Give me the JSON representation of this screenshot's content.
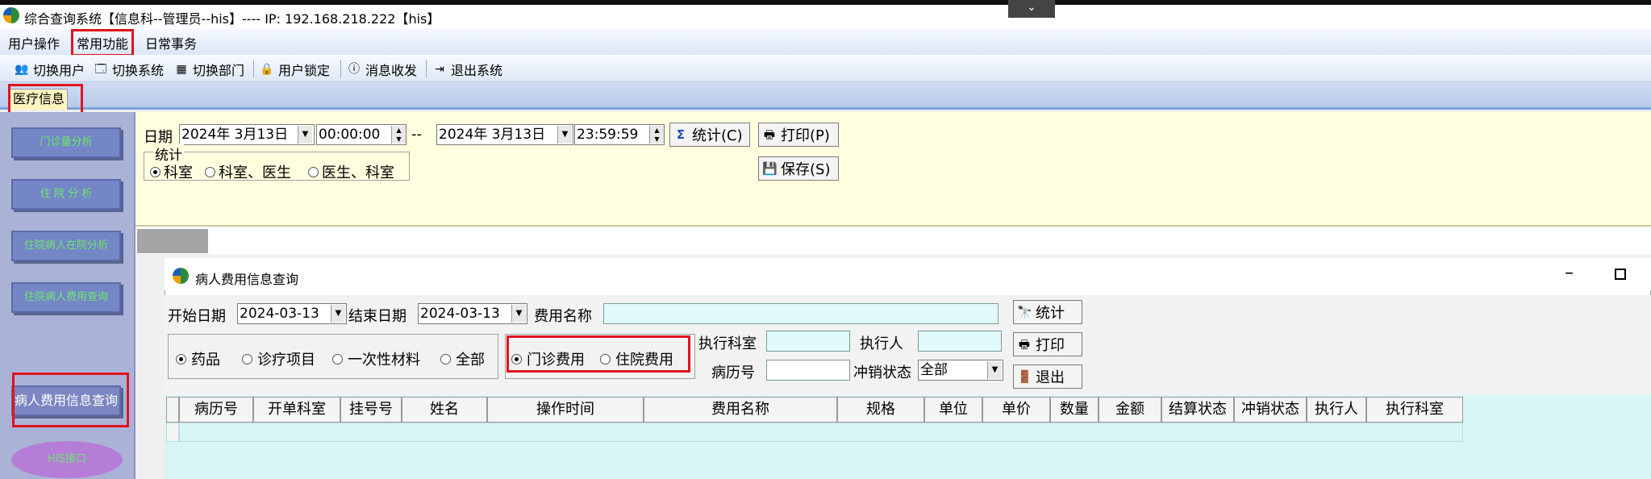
{
  "window": {
    "title": "综合查询系统【信息科--管理员--his】---- IP: 192.168.218.222【his】",
    "collapse_glyph": "⌄"
  },
  "menu": {
    "items": [
      "用户操作",
      "常用功能",
      "日常事务"
    ]
  },
  "toolbar": {
    "items": [
      "切换用户",
      "切换系统",
      "切换部门",
      "用户锁定",
      "消息收发",
      "退出系统"
    ]
  },
  "tabs": {
    "active": "医疗信息"
  },
  "sidebar": {
    "buttons": [
      "门诊量分析",
      "住 院 分 析",
      "住院病人在院分析",
      "住院病人费用查询",
      "病人费用信息查询"
    ],
    "oval": "HIS接口"
  },
  "query": {
    "date_label": "日期",
    "start_date": "2024年  3月13日",
    "start_time": "00:00:00",
    "separator": "--",
    "end_date": "2024年  3月13日",
    "end_time": "23:59:59",
    "stat_button": "统计(C)",
    "print_button": "打印(P)",
    "save_button": "保存(S)",
    "group_title": "统计",
    "radio_options": [
      "科室",
      "科室、医生",
      "医生、科室"
    ]
  },
  "inner_window": {
    "title": "病人费用信息查询",
    "start_label": "开始日期",
    "start_value": "2024-03-13",
    "end_label": "结束日期",
    "end_value": "2024-03-13",
    "fee_name_label": "费用名称",
    "fee_name_value": "",
    "category_options": [
      "药品",
      "诊疗项目",
      "一次性材料",
      "全部"
    ],
    "fee_type_options": [
      "门诊费用",
      "住院费用"
    ],
    "exec_dept_label": "执行科室",
    "executor_label": "执行人",
    "record_label": "病历号",
    "writeoff_label": "冲销状态",
    "writeoff_value": "全部",
    "btn_stat": "统计",
    "btn_print": "打印",
    "btn_exit": "退出",
    "columns": [
      "病历号",
      "开单科室",
      "挂号号",
      "姓名",
      "操作时间",
      "费用名称",
      "规格",
      "单位",
      "单价",
      "数量",
      "金额",
      "结算状态",
      "冲销状态",
      "执行人",
      "执行科室"
    ]
  },
  "colors": {
    "highlight": "#e0141e",
    "query_bg": "#ffffe0",
    "sidebar_bg": "#aab3d6",
    "grid_bg": "#d8f5f5"
  }
}
